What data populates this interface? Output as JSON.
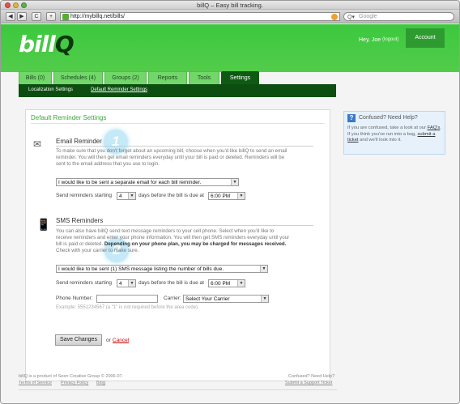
{
  "browser": {
    "window_title": "billQ – Easy bill tracking.",
    "url": "http://mybillq.net/bills/",
    "search_placeholder": "Google",
    "back_glyph": "◀",
    "forward_glyph": "▶",
    "reload_glyph": "C",
    "add_glyph": "+"
  },
  "header": {
    "logo_main": "bill",
    "logo_accent": "Q",
    "greeting": "Hey, Joe",
    "logout": "(logout)",
    "account": "Account"
  },
  "tabs": [
    {
      "label": "Bills (0)"
    },
    {
      "label": "Schedules (4)"
    },
    {
      "label": "Groups (2)"
    },
    {
      "label": "Reports"
    },
    {
      "label": "Tools"
    },
    {
      "label": "Settings"
    }
  ],
  "subnav": {
    "localization": "Localization Settings",
    "reminder": "Default Reminder Settings"
  },
  "panel": {
    "title": "Default Reminder Settings",
    "email": {
      "title": "Email Reminder",
      "badge": "1",
      "desc_lines": [
        "To make sure that you don't forget about an upcoming bill, choose when you'd like billQ to send an email",
        "reminder. You will then get email reminders everyday until your bill is paid or deleted. Reminders will be",
        "sent to the email address that you use to login."
      ],
      "mode_select": "I would like to be sent a separate email for each bill reminder.",
      "send_label": "Send reminders starting",
      "days_value": "4",
      "days_label": "days before the bill is due at",
      "time_value": "6:00 PM"
    },
    "sms": {
      "title": "SMS Reminders",
      "badge": "2",
      "desc_lines": [
        "You can also have billQ send text message reminders to your cell phone. Select when you'd like to",
        "receive reminders and enter your phone information. You will then get SMS reminders everyday until your",
        "bill is paid or deleted.",
        "Depending on your phone plan, you may be charged for messages received.",
        "Check with your carrier to make sure."
      ],
      "mode_select": "I would like to be sent (1) SMS message listing the number of bills due.",
      "send_label": "Send reminders starting",
      "days_value": "4",
      "days_label": "days before the bill is due at",
      "time_value": "6:00 PM",
      "phone_label": "Phone Number:",
      "phone_value": "",
      "carrier_label": "Carrier:",
      "carrier_value": "Select Your Carrier",
      "example": "Example: 5551234567 (a \"1\" is not required before the area code)."
    },
    "save": "Save Changes",
    "or": "or",
    "cancel": "Cancel"
  },
  "help": {
    "title": "Confused? Need Help?",
    "line1": "If you are confused, take a look at our",
    "faq": "FAQ's",
    "line2": ". If you think you've run into a bug,",
    "ticket": "submit a ticket",
    "line3": " and we'll look into it."
  },
  "footer": {
    "copyright": "billQ is a product of Seen Creative Group © 2006-07.",
    "terms": "Terms of Service",
    "privacy": "Privacy Policy",
    "blog": "Blog",
    "help_q": "Confused? Need Help?",
    "support": "Submit a Support Ticket"
  }
}
